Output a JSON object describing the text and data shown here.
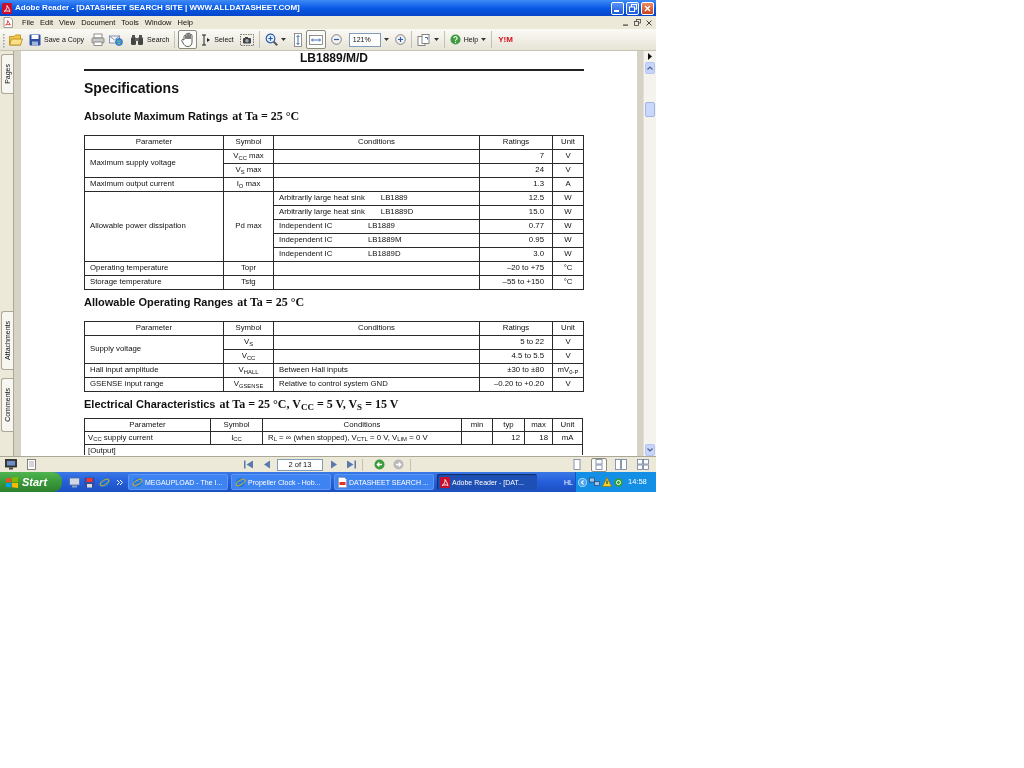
{
  "window": {
    "title": "Adobe Reader - [DATASHEET SEARCH SITE | WWW.ALLDATASHEET.COM]"
  },
  "menu": [
    "File",
    "Edit",
    "View",
    "Document",
    "Tools",
    "Window",
    "Help"
  ],
  "toolbar": {
    "save_copy": "Save a Copy",
    "search": "Search",
    "tools": [
      {
        "selected": true
      },
      {
        "label": "Select",
        "selected": false
      },
      {
        "selected": false
      }
    ],
    "fit_modes": [
      {
        "selected": false
      },
      {
        "selected": true
      }
    ],
    "zoom": "121%",
    "help": "Help",
    "messenger": "Y!M"
  },
  "side_tabs": [
    "Pages",
    "Attachments",
    "Comments"
  ],
  "document": {
    "header": "LB1889/M/D",
    "title": "Specifications",
    "sections": [
      {
        "kind": "ratings",
        "title": "Absolute Maximum Ratings",
        "condition": "at Ta = 25 °C",
        "columns": [
          "Parameter",
          "Symbol",
          "Conditions",
          "Ratings",
          "Unit"
        ],
        "rows": [
          {
            "parameter": "Maximum supply voltage",
            "entries": [
              {
                "symbol": "V$_{CC}$ max",
                "ratings": "7",
                "unit": "V"
              },
              {
                "symbol": "V$_{S}$ max",
                "ratings": "24",
                "unit": "V"
              }
            ]
          },
          {
            "parameter": "Maximum output current",
            "entries": [
              {
                "symbol": "I$_{O}$ max",
                "ratings": "1.3",
                "unit": "A"
              }
            ]
          },
          {
            "parameter": "Allowable power dissipation",
            "symbol": "Pd max",
            "entries": [
              {
                "conditions": "Arbitrarily large heat sink",
                "device": "LB1889",
                "ratings": "12.5",
                "unit": "W"
              },
              {
                "conditions": "Arbitrarily large heat sink",
                "device": "LB1889D",
                "ratings": "15.0",
                "unit": "W"
              },
              {
                "conditions": "Independent IC",
                "device": "LB1889",
                "ratings": "0.77",
                "unit": "W"
              },
              {
                "conditions": "Independent IC",
                "device": "LB1889M",
                "ratings": "0.95",
                "unit": "W"
              },
              {
                "conditions": "Independent IC",
                "device": "LB1889D",
                "ratings": "3.0",
                "unit": "W"
              }
            ]
          },
          {
            "parameter": "Operating temperature",
            "entries": [
              {
                "symbol": "Topr",
                "ratings": "–20 to +75",
                "unit": "°C"
              }
            ]
          },
          {
            "parameter": "Storage temperature",
            "entries": [
              {
                "symbol": "Tstg",
                "ratings": "–55 to +150",
                "unit": "°C"
              }
            ]
          }
        ]
      },
      {
        "kind": "ratings",
        "title": "Allowable Operating Ranges",
        "condition": "at Ta = 25 °C",
        "columns": [
          "Parameter",
          "Symbol",
          "Conditions",
          "Ratings",
          "Unit"
        ],
        "rows": [
          {
            "parameter": "Supply voltage",
            "entries": [
              {
                "symbol": "V$_{S}$",
                "ratings": "5 to 22",
                "unit": "V"
              },
              {
                "symbol": "V$_{CC}$",
                "ratings": "4.5 to 5.5",
                "unit": "V"
              }
            ]
          },
          {
            "parameter": "Hall input amplitude",
            "entries": [
              {
                "symbol": "V$_{HALL}$",
                "conditions": "Between Hall inputs",
                "ratings": "±30 to ±80",
                "unit": "mV$_{0-P}$"
              }
            ]
          },
          {
            "parameter": "GSENSE input range",
            "entries": [
              {
                "symbol": "V$_{GSENSE}$",
                "conditions": "Relative to control system GND",
                "ratings": "–0.20 to +0.20",
                "unit": "V"
              }
            ]
          }
        ]
      },
      {
        "kind": "characteristics",
        "title": "Electrical Characteristics",
        "condition": "at Ta = 25 °C, V$_{CC}$ = 5 V, V$_{S}$ = 15 V",
        "columns": [
          "Parameter",
          "Symbol",
          "Conditions",
          "min",
          "typ",
          "max",
          "Unit"
        ],
        "rows": [
          {
            "kind": "item",
            "parameter": "V$_{CC}$ supply current",
            "symbol": "I$_{CC}$",
            "conditions": "R$_{L}$ = ∞ (when stopped), V$_{CTL}$ = 0 V, V$_{LIM}$ = 0 V",
            "typ": "12",
            "max": "18",
            "unit": "mA"
          },
          {
            "kind": "section",
            "label": "[Output]"
          }
        ]
      }
    ]
  },
  "navigation": {
    "page": "2 of 13",
    "history": [
      {
        "disabled": false
      },
      {
        "disabled": true
      }
    ],
    "page_layouts": [
      {
        "selected": false
      },
      {
        "selected": true
      },
      {
        "selected": false
      },
      {
        "selected": false
      }
    ]
  },
  "taskbar": {
    "start": "Start",
    "tasks": [
      {
        "label": "MEGAUPLOAD - The I...",
        "selected": false
      },
      {
        "label": "Propeller Clock - Hob...",
        "selected": false
      },
      {
        "label": "DATASHEET SEARCH ...",
        "selected": false
      },
      {
        "label": "Adobe Reader - [DAT...",
        "selected": true
      }
    ],
    "language": "HL",
    "time": "14:58"
  }
}
